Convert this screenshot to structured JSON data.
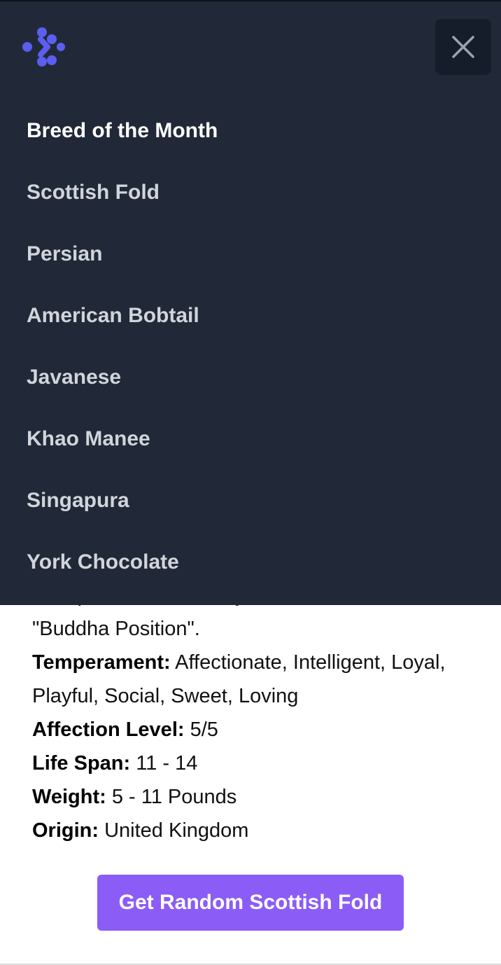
{
  "menu": {
    "logo_icon": "dots-logo-icon",
    "close_icon": "close-icon",
    "items": [
      {
        "label": "Breed of the Month",
        "active": true
      },
      {
        "label": "Scottish Fold"
      },
      {
        "label": "Persian"
      },
      {
        "label": "American Bobtail"
      },
      {
        "label": "Javanese"
      },
      {
        "label": "Khao Manee"
      },
      {
        "label": "Singapura"
      },
      {
        "label": "York Chocolate"
      }
    ],
    "colors": {
      "background": "#212938",
      "accent": "#5b5ef0"
    }
  },
  "details": {
    "description_cut_line": "their paws on their belly. This is called the",
    "description_end": "\"Buddha Position\".",
    "temperament_label": "Temperament:",
    "temperament_value": " Affectionate, Intelligent, Loyal, Playful, Social, Sweet, Loving",
    "affection_label": "Affection Level:",
    "affection_value": " 5/5",
    "lifespan_label": "Life Span:",
    "lifespan_value": " 11 - 14",
    "weight_label": "Weight:",
    "weight_value": " 5 - 11 Pounds",
    "origin_label": "Origin:",
    "origin_value": " United Kingdom"
  },
  "cta": {
    "label": "Get Random Scottish Fold",
    "color": "#8b5cf6"
  }
}
